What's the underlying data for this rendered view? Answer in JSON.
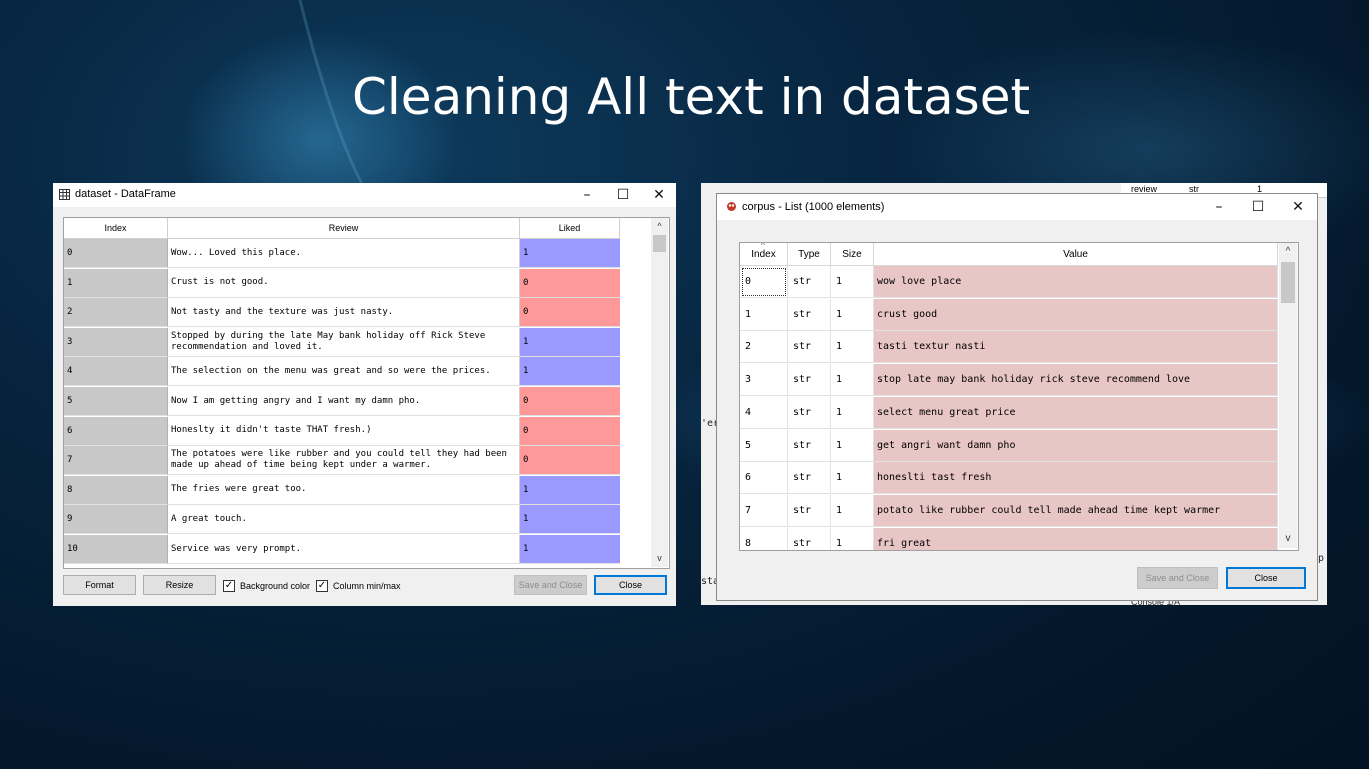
{
  "slide": {
    "title": "Cleaning All text in dataset"
  },
  "dataframe_window": {
    "title": "dataset - DataFrame",
    "columns": {
      "index": "Index",
      "review": "Review",
      "liked": "Liked"
    },
    "rows": [
      {
        "index": "0",
        "review": "Wow... Loved this place.",
        "liked": "1"
      },
      {
        "index": "1",
        "review": "Crust is not good.",
        "liked": "0"
      },
      {
        "index": "2",
        "review": "Not tasty and the texture was just nasty.",
        "liked": "0"
      },
      {
        "index": "3",
        "review": "Stopped by during the late May bank holiday off Rick Steve recommendation and loved it.",
        "liked": "1"
      },
      {
        "index": "4",
        "review": "The selection on the menu was great and so were the prices.",
        "liked": "1"
      },
      {
        "index": "5",
        "review": "Now I am getting angry and I want my damn pho.",
        "liked": "0"
      },
      {
        "index": "6",
        "review": "Honeslty it didn't taste THAT fresh.)",
        "liked": "0"
      },
      {
        "index": "7",
        "review": "The potatoes were like rubber and you could tell they had been made up ahead of time being kept under a warmer.",
        "liked": "0"
      },
      {
        "index": "8",
        "review": "The fries were great too.",
        "liked": "1"
      },
      {
        "index": "9",
        "review": "A great touch.",
        "liked": "1"
      },
      {
        "index": "10",
        "review": "Service was very prompt.",
        "liked": "1"
      }
    ],
    "buttons": {
      "format": "Format",
      "resize": "Resize",
      "background_color": "Background color",
      "column_minmax": "Column min/max",
      "save_close": "Save and Close",
      "close": "Close"
    },
    "checkboxes": {
      "background_color_checked": true,
      "column_minmax_checked": true
    },
    "colors": {
      "liked_1": "#9999ff",
      "liked_0": "#ff9999",
      "index_bg": "#c8c8c8"
    }
  },
  "list_window": {
    "title": "corpus - List (1000 elements)",
    "columns": {
      "index": "Index",
      "type": "Type",
      "size": "Size",
      "value": "Value"
    },
    "rows": [
      {
        "index": "0",
        "type": "str",
        "size": "1",
        "value": "wow love place"
      },
      {
        "index": "1",
        "type": "str",
        "size": "1",
        "value": "crust good"
      },
      {
        "index": "2",
        "type": "str",
        "size": "1",
        "value": "tasti textur nasti"
      },
      {
        "index": "3",
        "type": "str",
        "size": "1",
        "value": "stop late may bank holiday rick steve recommend love"
      },
      {
        "index": "4",
        "type": "str",
        "size": "1",
        "value": "select menu great price"
      },
      {
        "index": "5",
        "type": "str",
        "size": "1",
        "value": "get angri want damn pho"
      },
      {
        "index": "6",
        "type": "str",
        "size": "1",
        "value": "honeslti tast fresh"
      },
      {
        "index": "7",
        "type": "str",
        "size": "1",
        "value": "potato like rubber could tell made ahead time kept warmer"
      },
      {
        "index": "8",
        "type": "str",
        "size": "1",
        "value": "fri great"
      }
    ],
    "buttons": {
      "save_close": "Save and Close",
      "close": "Close"
    },
    "colors": {
      "value_bg": "#e8c6c6"
    }
  },
  "background_window": {
    "header_cells": [
      "review",
      "str",
      "1"
    ],
    "fragment_left": "'er",
    "fragment_sta": "sta",
    "fragment_p": "p",
    "console_tab": "Console 1/A"
  }
}
